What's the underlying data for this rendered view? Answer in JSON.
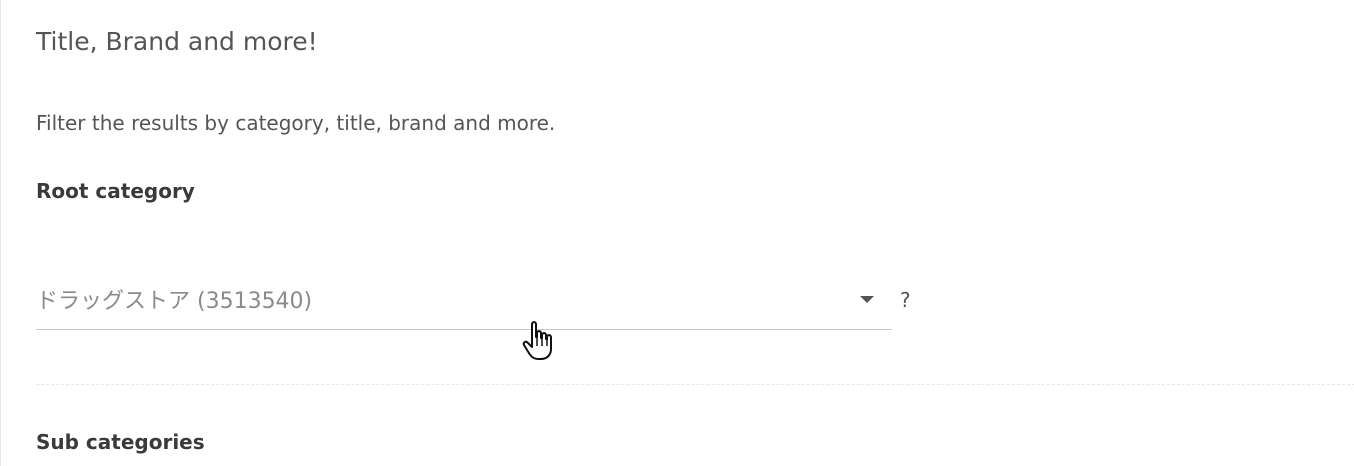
{
  "section": {
    "title": "Title, Brand and more!",
    "description": "Filter the results by category, title, brand and more."
  },
  "root_category": {
    "label": "Root category",
    "selected_value": "ドラッグストア (3513540)",
    "help_text": "?"
  },
  "sub_categories": {
    "label": "Sub categories"
  },
  "icons": {
    "dropdown": "caret-down-icon",
    "cursor": "hand-pointer-cursor-icon"
  },
  "colors": {
    "text": "#555555",
    "label": "#3a3a3a",
    "placeholder": "#8a8a8a",
    "underline": "#c8c8c8"
  }
}
